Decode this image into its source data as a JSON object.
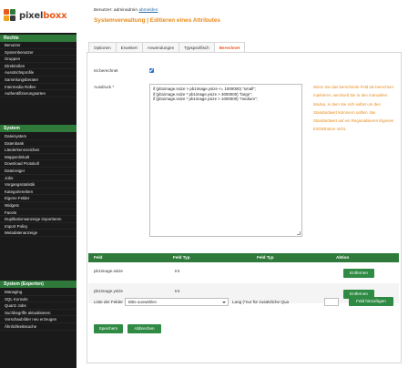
{
  "brand": {
    "name_prefix": "pixel",
    "name_suffix": "boxx",
    "logo_colors": [
      "#e85a1a",
      "#2f7a3a",
      "#f2a31b",
      "#3a3a3a"
    ]
  },
  "colors": {
    "accent": "#e88a1a",
    "section_green": "#2f7a3a",
    "button_green": "#2f8a44",
    "sidebar_bg": "#1a1a1a",
    "link": "#2d6fae"
  },
  "header": {
    "user_prefix": "Benutzer: adminadmin ",
    "user_link": "abmelden",
    "title": "Systemverwaltung | Editieren eines Attributes"
  },
  "sidebar": {
    "sections": [
      {
        "title": "Rechte",
        "items": [
          "Benutzer",
          "Systembenutzer",
          "Gruppen",
          "Direktrollen",
          "Ausstrichsprofile",
          "Sammlungsberater",
          "Intermedia Rollen",
          "Authentifizierungsarten"
        ]
      },
      {
        "title": "System",
        "items": [
          "Dateisystem",
          "Datenbank",
          "Länderkennzeichen",
          "Mappenlinkalt",
          "Download Protokoll",
          "Dateizeiger",
          "Jobs",
          "Vorgangsstatistik",
          "Kategorieneben",
          "Eigene Felder",
          "Widgets",
          "Facets",
          "Duplikationsanzeige importieren",
          "Import Policy",
          "Metadatenanzeige"
        ]
      },
      {
        "title": "System (Experten)",
        "items": [
          "Managing",
          "SQL Konsole",
          "Quartz Jobs",
          "Suchbegriffe aktualisieren",
          "Vorschaubilder neu erzeugen",
          "Ähnlichkeitssuche"
        ]
      }
    ]
  },
  "tabs": [
    {
      "label": "Optionen",
      "active": false
    },
    {
      "label": "Erweitert",
      "active": false
    },
    {
      "label": "Anwendungen",
      "active": false
    },
    {
      "label": "Typspezifisch",
      "active": false
    },
    {
      "label": "Berechnet",
      "active": true
    }
  ],
  "form": {
    "is_computed_label": "Ist berechnet",
    "is_computed_checked": true,
    "expression_label": "Ausdruck *",
    "expression_lines": [
      "if (pb1image.ssize > pb1image.ysize <= 1000000) \"small\";",
      "if (pb1image.ssize * pb1image.ysize > 3000000) \"large\";",
      "if (pb1image.ssize * pb1image.ysize > 1000000) \"medium\";"
    ],
    "help_text": "Wenn Sie das berechnete Feld als berechnet markieren, wechselt Sie in den manuellen Modus, in dem Sie sich selbst um den Standardwert kümmern sollten. Bei Standardwert auf ein Regionalsieren Eigenen Einfeldname nicht."
  },
  "table": {
    "headers": [
      "Feld",
      "Feld Typ",
      "Feld Typ",
      "Aktion"
    ],
    "rows": [
      {
        "field": "pb1image.ssize",
        "type": "Int",
        "action": "Entfernen"
      },
      {
        "field": "pb1image.ysize",
        "type": "Int",
        "action": "Entfernen"
      }
    ]
  },
  "add_field": {
    "list_label": "Liste der Felder",
    "select_value": "Bitte auswählen",
    "length_label": "Lang (*nur für zusätzliche Qua",
    "length_value": "",
    "add_button": "Feld hinzufügen"
  },
  "footer": {
    "save": "Speichern",
    "cancel": "Abbrechen"
  }
}
